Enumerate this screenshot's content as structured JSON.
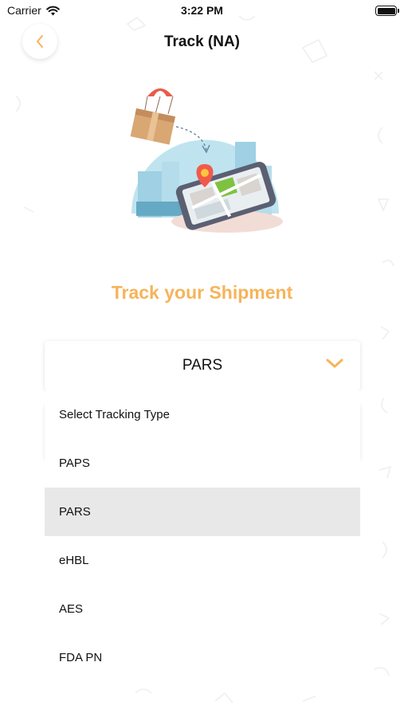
{
  "status_bar": {
    "carrier": "Carrier",
    "time": "3:22 PM"
  },
  "nav": {
    "title": "Track (NA)"
  },
  "heading": "Track your Shipment",
  "select": {
    "value": "PARS"
  },
  "dropdown": {
    "options": [
      "Select Tracking Type",
      "PAPS",
      "PARS",
      "eHBL",
      "AES",
      "FDA PN"
    ],
    "selected_index": 2
  },
  "colors": {
    "accent": "#f6b45a",
    "selected_row": "#e8e8e8"
  },
  "icons": [
    "wifi-icon",
    "battery-icon",
    "back-chevron-icon",
    "chevron-down-icon"
  ]
}
